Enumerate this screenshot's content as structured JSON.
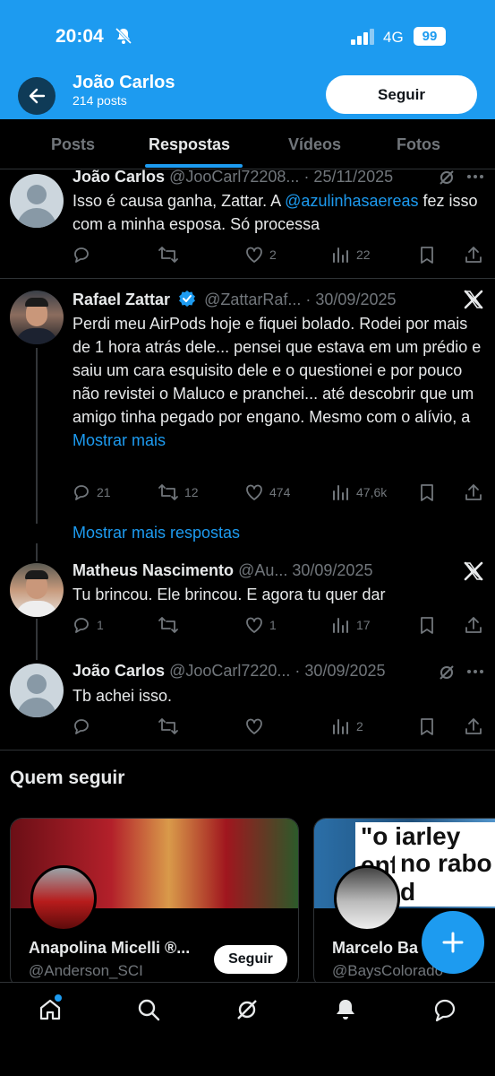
{
  "status_bar": {
    "time": "20:04",
    "network": "4G",
    "battery": "99"
  },
  "header": {
    "name": "João Carlos",
    "posts": "214 posts",
    "follow_label": "Seguir"
  },
  "tabs": [
    {
      "label": "Posts"
    },
    {
      "label": "Respostas"
    },
    {
      "label": "Vídeos"
    },
    {
      "label": "Fotos"
    }
  ],
  "posts": [
    {
      "name": "João Carlos",
      "handle": "@JooCarl72208...",
      "date": "· 25/11/2025",
      "text_before": "Isso é causa ganha, Zattar. A ",
      "mention": "@azulinhasaereas",
      "text_after": " fez isso com a minha esposa. Só processa",
      "replies": "",
      "retweets": "",
      "likes": "2",
      "views": "22"
    },
    {
      "name": "Rafael Zattar",
      "handle": "@ZattarRaf...",
      "date": "· 30/09/2025",
      "text": "Perdi meu AirPods hoje e fiquei bolado. Rodei por mais de 1 hora atrás dele... pensei que estava em um prédio e saiu um cara esquisito dele e o questionei e por pouco não revistei o Maluco e pranchei... até descobrir que um amigo tinha pegado por engano. Mesmo com o alívio, a ",
      "show_more": "Mostrar mais",
      "replies": "21",
      "retweets": "12",
      "likes": "474",
      "views": "47,6k"
    },
    {
      "name": "Matheus Nascimento",
      "handle": "@Au...",
      "date": "30/09/2025",
      "text": "Tu brincou. Ele brincou. E agora tu quer dar",
      "replies": "1",
      "retweets": "",
      "likes": "1",
      "views": "17"
    },
    {
      "name": "João Carlos",
      "handle": "@JooCarl7220...",
      "date": "· 30/09/2025",
      "text": "Tb achei isso.",
      "replies": "",
      "retweets": "",
      "likes": "",
      "views": "2"
    }
  ],
  "show_more_replies": "Mostrar mais respostas",
  "who_to_follow": {
    "title": "Quem seguir",
    "cards": [
      {
        "name": "Anapolina Micelli ®...",
        "handle": "@Anderson_SCI",
        "follow_label": "Seguir"
      },
      {
        "name": "Marcelo Ba",
        "handle": "@BaysColorado",
        "banner_text_1": "\"o iarley enfi",
        "banner_text_2": "no rabo d"
      }
    ]
  },
  "colors": {
    "accent": "#1d9bf0",
    "background": "#000000",
    "muted": "#71767b",
    "text": "#e7e9ea"
  },
  "icons": [
    "back-arrow-icon",
    "bell-off-icon",
    "verified-badge-icon",
    "x-logo-icon",
    "grok-icon",
    "more-icon",
    "reply-icon",
    "retweet-icon",
    "like-icon",
    "views-icon",
    "bookmark-icon",
    "share-icon",
    "compose-plus-icon",
    "home-icon",
    "search-icon",
    "notifications-icon",
    "messages-icon"
  ]
}
